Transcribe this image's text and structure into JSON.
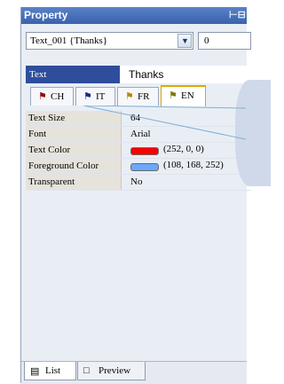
{
  "window": {
    "title": "Property",
    "pin_icon": "pin-icon"
  },
  "selector": {
    "value": "Text_001 {Thanks}",
    "number": "0"
  },
  "text_property": {
    "label": "Text",
    "value": "Thanks"
  },
  "tabs": [
    {
      "label": "CH",
      "icon": "flag-icon",
      "flag_color": "#8a1010",
      "active": false
    },
    {
      "label": "IT",
      "icon": "flag-icon",
      "flag_color": "#1c2a7a",
      "active": false
    },
    {
      "label": "FR",
      "icon": "flag-icon",
      "flag_color": "#b8860b",
      "active": false
    },
    {
      "label": "EN",
      "icon": "flag-icon",
      "flag_color": "#7a7a10",
      "active": true
    }
  ],
  "properties": [
    {
      "name": "Text Size",
      "value": "64"
    },
    {
      "name": "Font",
      "value": "Arial"
    },
    {
      "name": "Text Color",
      "value": "(252, 0, 0)",
      "swatch": "#fc0000"
    },
    {
      "name": "Foreground Color",
      "value": "(108, 168, 252)",
      "swatch": "#6ca8fc"
    },
    {
      "name": "Transparent",
      "value": "No"
    }
  ],
  "bottom_tabs": [
    {
      "label": "List",
      "icon": "list-icon"
    },
    {
      "label": "Preview",
      "icon": "preview-icon"
    }
  ],
  "colors": {
    "title_bar": "#3a62ad",
    "selected_label": "#2e4e9c",
    "active_tab_border": "#e0a800"
  }
}
